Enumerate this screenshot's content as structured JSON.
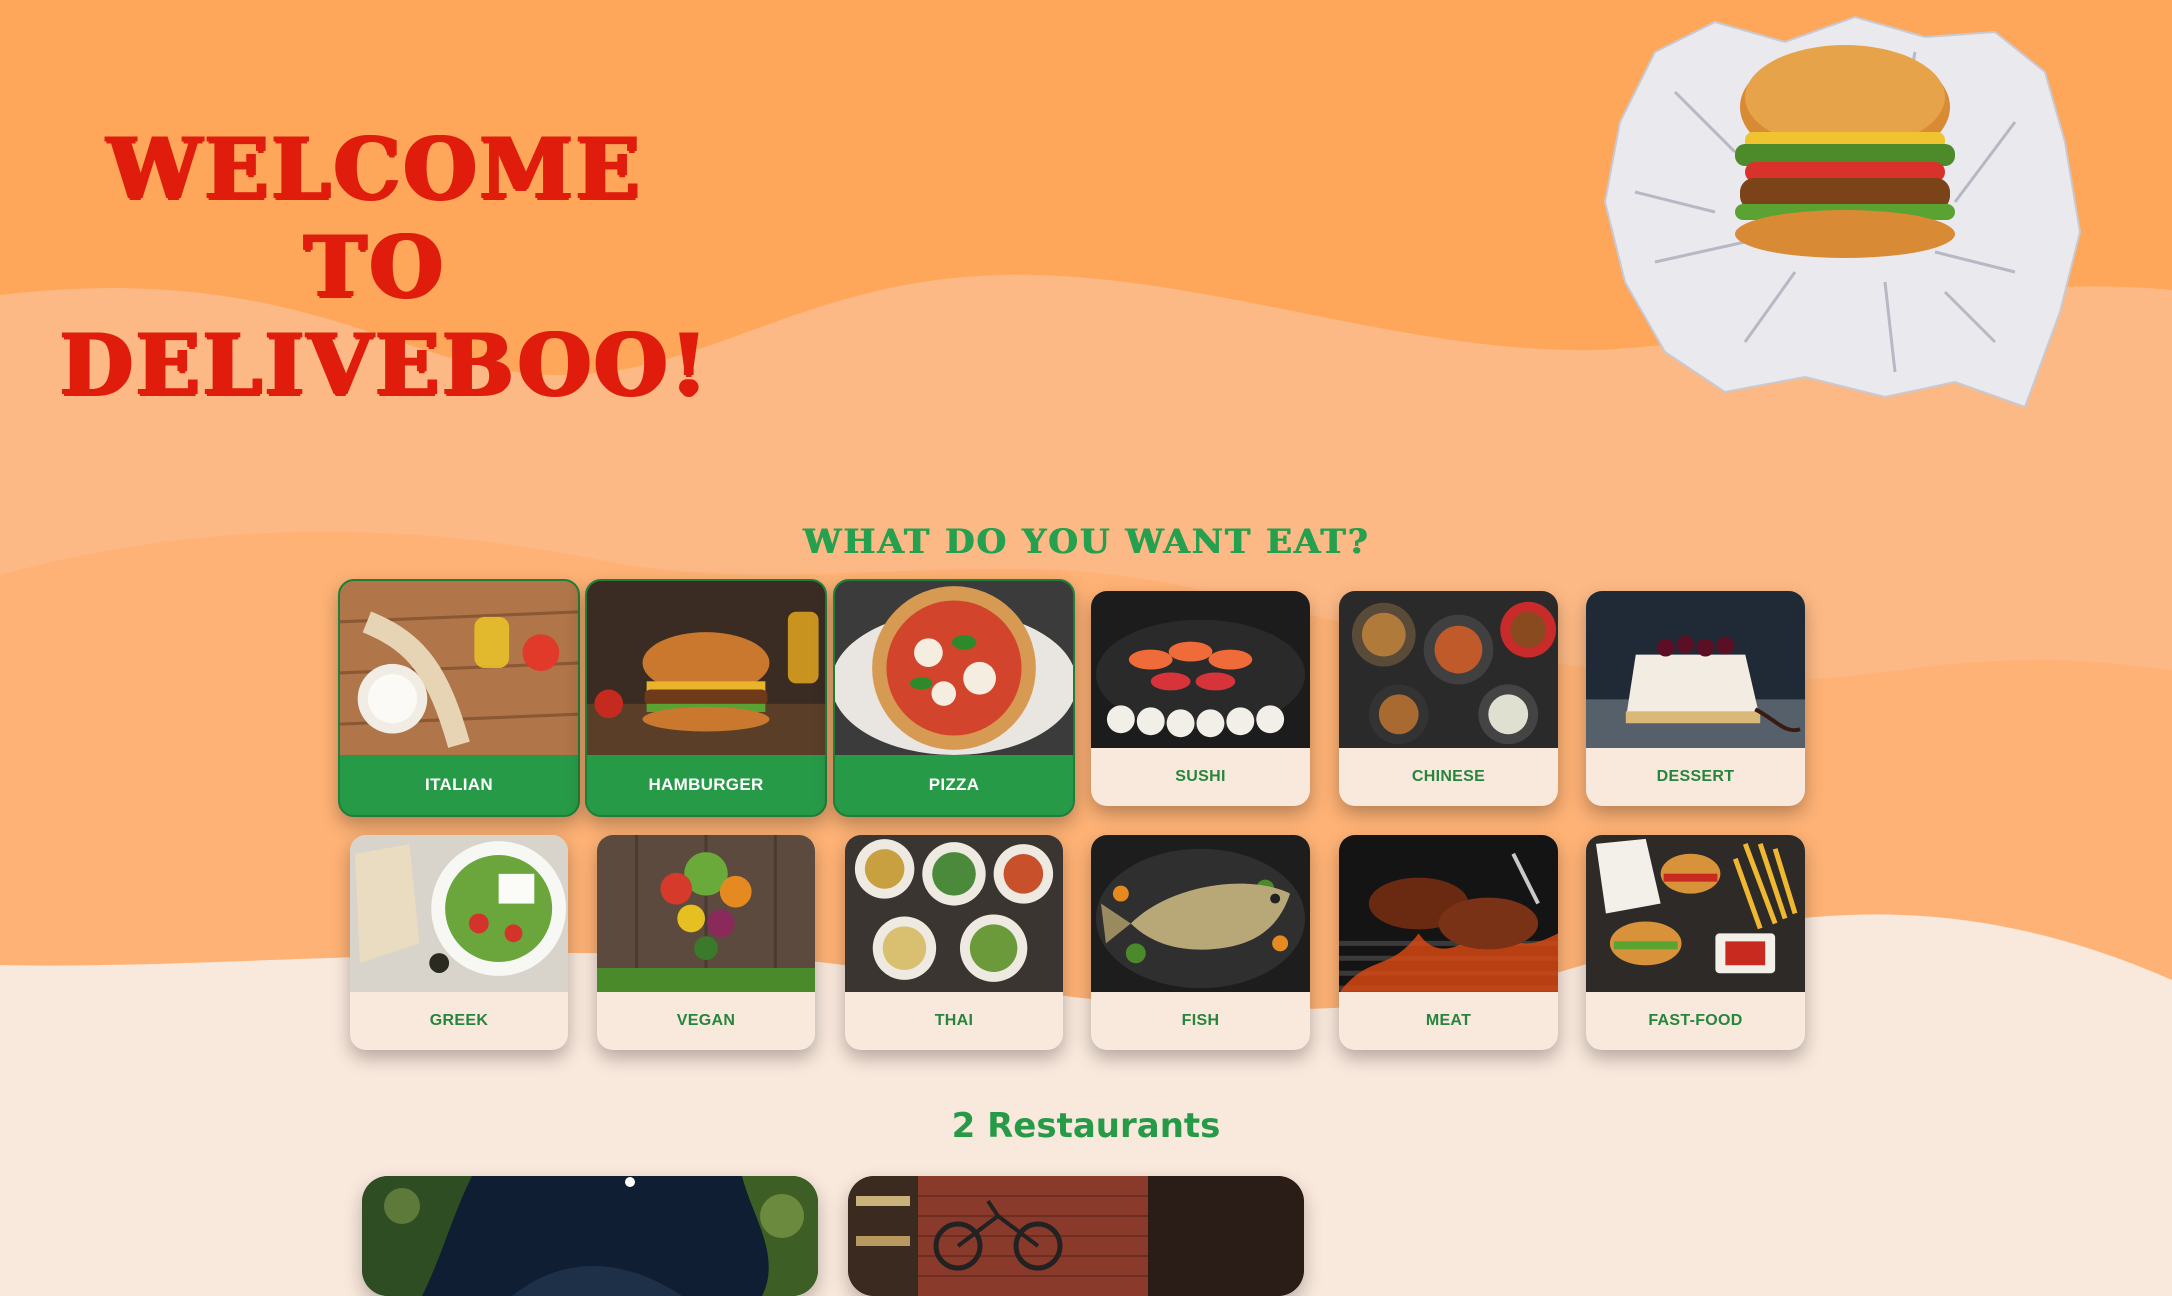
{
  "hero": {
    "title_line1": "WELCOME TO",
    "title_line2": "DELIVEBOO!",
    "image_icon": "burger-in-paper-illustration"
  },
  "categories_section": {
    "title": "WHAT DO YOU WANT EAT?",
    "categories": [
      {
        "label": "ITALIAN",
        "selected": true,
        "icon": "italian-food-photo"
      },
      {
        "label": "HAMBURGER",
        "selected": true,
        "icon": "hamburger-photo"
      },
      {
        "label": "PIZZA",
        "selected": true,
        "icon": "pizza-photo"
      },
      {
        "label": "SUSHI",
        "selected": false,
        "icon": "sushi-photo"
      },
      {
        "label": "CHINESE",
        "selected": false,
        "icon": "chinese-food-photo"
      },
      {
        "label": "DESSERT",
        "selected": false,
        "icon": "dessert-photo"
      },
      {
        "label": "GREEK",
        "selected": false,
        "icon": "greek-food-photo"
      },
      {
        "label": "VEGAN",
        "selected": false,
        "icon": "vegan-food-photo"
      },
      {
        "label": "THAI",
        "selected": false,
        "icon": "thai-food-photo"
      },
      {
        "label": "FISH",
        "selected": false,
        "icon": "fish-photo"
      },
      {
        "label": "MEAT",
        "selected": false,
        "icon": "meat-photo"
      },
      {
        "label": "FAST-FOOD",
        "selected": false,
        "icon": "fast-food-photo"
      }
    ]
  },
  "restaurants": {
    "count_label": "2 Restaurants",
    "cards": [
      {
        "icon": "restaurant-night-garden-photo"
      },
      {
        "icon": "restaurant-brick-interior-photo"
      }
    ]
  },
  "colors": {
    "hero_bg": "#fea75a",
    "mid_band": "#fdb985",
    "page_bg": "#f9e8dc",
    "title_red": "#e01d0c",
    "accent_green": "#279a48"
  }
}
